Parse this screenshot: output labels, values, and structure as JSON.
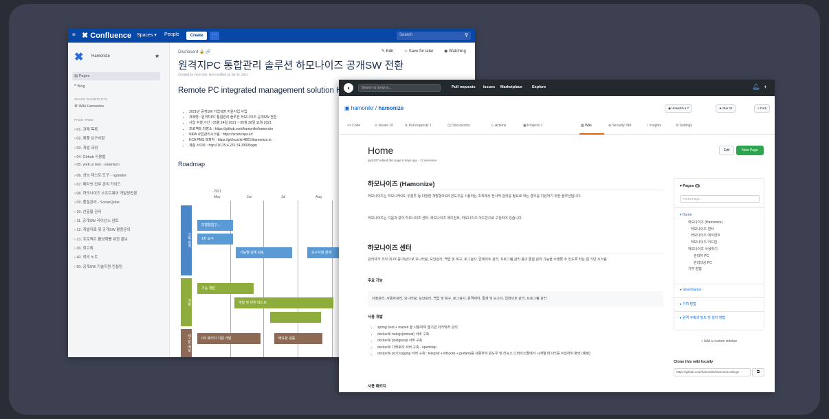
{
  "confluence": {
    "menu_icon": "hamburger-icon",
    "logo": "✖ Confluence",
    "nav": [
      "Spaces ▾",
      "People"
    ],
    "create": "Create",
    "more": "···",
    "search": "Search",
    "space_name": "Hamonize",
    "sidebar": {
      "pages": "Pages",
      "blog": "Blog",
      "shortcuts_label": "SPACE SHORTCUTS",
      "shortcut": "Wiki Hamonize",
      "tree_label": "PAGE TREE",
      "tree": [
        "01. 과제 목록",
        "02. 제품 요구사항",
        "03. 개발 과정",
        "04. Github 사용법",
        "05. web ui test - selenium",
        "06. 성능 테스트 도구 - ngrinder",
        "07. 메타넷 업무 관리 가이드",
        "08. 하모나이즈 소프트웨어 개발방법론",
        "09. 품질관리 - SonarQube",
        "10. 산출물 관리",
        "11. 공개SW 라이선스 검토",
        "12. 개발자료 및 공개SW 활용문의",
        "13. 프로젝트 활성화를 위한 홍보",
        "30. 회고록",
        "40. 회의 노트",
        "50. 공개SW 기술지원 컨설팅"
      ]
    },
    "breadcrumb": "Dashboard",
    "actions": [
      "✎ Edit",
      "☆ Save for later",
      "◉ Watching"
    ],
    "title_kr": "원격지PC 통합관리 솔루션 하모나이즈 공개SW 전환",
    "byline": "Created by Yoon Kim, last modified on Jul 30, 2021",
    "title_en": "Remote PC integrated management solution Hamonize open SW conversion",
    "bullets": [
      "2021년 공개SW 기업성장 지원사업 사업",
      "과제명 : 원격지PC 통합관리 솔루션 하모나이즈 공개SW 전환",
      "사업 수행 기간 : 05월 14일 2021 ~ 05월 30일 11월 2021",
      "프로젝트 저장소 : https://github.com/hamonikr/hamonize",
      "NIPA 사업관리시스템 : https://snsw.nipa.kr/",
      "KCA PMS 레파지 : https://git.kcai.kr/4801/ihamonize.io",
      "계층 사이트 : http://10.25.4.231:74.3300/login"
    ],
    "roadmap": "Roadmap",
    "rm_year": "2021",
    "rm_months": [
      "May",
      "Jun",
      "Jul",
      "Aug"
    ],
    "rm_lanes": [
      "기획·설계",
      "개발",
      "테스트·배포"
    ],
    "rm_bars": [
      "모델협업구...",
      "1차 요구",
      "기능별 설계 검토",
      "요구사항 설계",
      "기능 개발",
      "개발 및 단위 테스트",
      "OS 패키지 지원 개발",
      "배포판 검증"
    ]
  },
  "github": {
    "search": "Search or jump to...",
    "nav": [
      "Pull requests",
      "Issues",
      "Marketplace",
      "Explore"
    ],
    "repo_owner": "hamonikr",
    "repo_name": "hamonize",
    "unwatch": "◉ Unwatch ▾  7",
    "star": "★ Star  11",
    "fork": "⑂ Fork",
    "tabs": [
      "<> Code",
      "⊙ Issues 10",
      "⇅ Pull requests 1",
      "◫ Discussions",
      "▷ Actions",
      "▦ Projects 1",
      "▥ Wiki",
      "⊕ Security 349",
      "⌇ Insights",
      "⚙ Settings"
    ],
    "wiki_title": "Home",
    "wiki_meta": "jay0427 edited this page 6 days ago · 12 revisions",
    "edit": "Edit",
    "new_page": "New Page",
    "h2a": "하모나이즈 (Hamonize)",
    "p1": "하모나이즈는 하모니카OS, 우분투 등 다양한 개방형OS와 윈도우를 사용하는 조직에서 전사적 관리를 필요로 하는 경우를 지원하기 위한 솔루션입니다.",
    "p2": "하모나이즈는 다음과 같이 하모나이즈 센터, 하모나이즈 에이전트, 하모나이즈 어드민으로 구성되어 있습니다.",
    "h2b": "하모나이즈 센터",
    "p3": "관리자가 조직 내 PC를 대상으로 모니터링, 보안관리, 백업 및 복구, 로그검사, 업데이트 관리, 프로그램 관리 등의 통합 관리 기능을 수행할 수 있도록 하는 웹 기반 시스템",
    "h4a": "주요 기능",
    "features": "지정관리, 사용자관리, 모니터링, 보안관리, 백업 및 복구, 로그검사, 원격제어, 통계 및 보고서, 업데이트 관리, 프로그램 관리",
    "h4b": "사용 개발",
    "dev": [
      "spring boot + maven 을 사용하여 웹기반 아키텍처 관리",
      "docker로 nodejs(tomcat) 서버 구축",
      "docker로 postgresql 서버 구축",
      "docker로 디렉토리 서버 구축 - openldap",
      "docker로 pc의 logging 서버 구축 : telegraf + influxdb + grafana를 사용하여 윈도우 및 리눅스 디바이스들에서 시계열 데이터를 수집하여 출력 (예정)"
    ],
    "h4c": "사용 패키지",
    "pages_label": "Pages",
    "pages_count": "9",
    "find_page": "Find a Page...",
    "page_tree": [
      "▾ Home",
      "하모나이즈 (Hamonize)",
      "하모나이즈 센터",
      "하모나이즈 에이전트",
      "하모나이즈 어드민",
      "하모나이즈 사용하기",
      "관리자 PC",
      "관리대상 PC",
      "기여 방법"
    ],
    "pages_more": [
      "▸ Governance",
      "▸ 기여 방법",
      "▸ 원격 구축과 빌드 및 설치 방법"
    ],
    "add_sidebar": "+ Add a custom sidebar",
    "clone_label": "Clone this wiki locally",
    "clone_url": "https://github.com/hamonikr/hamonize.wiki.git",
    "clone_icon": "clipboard-icon"
  }
}
